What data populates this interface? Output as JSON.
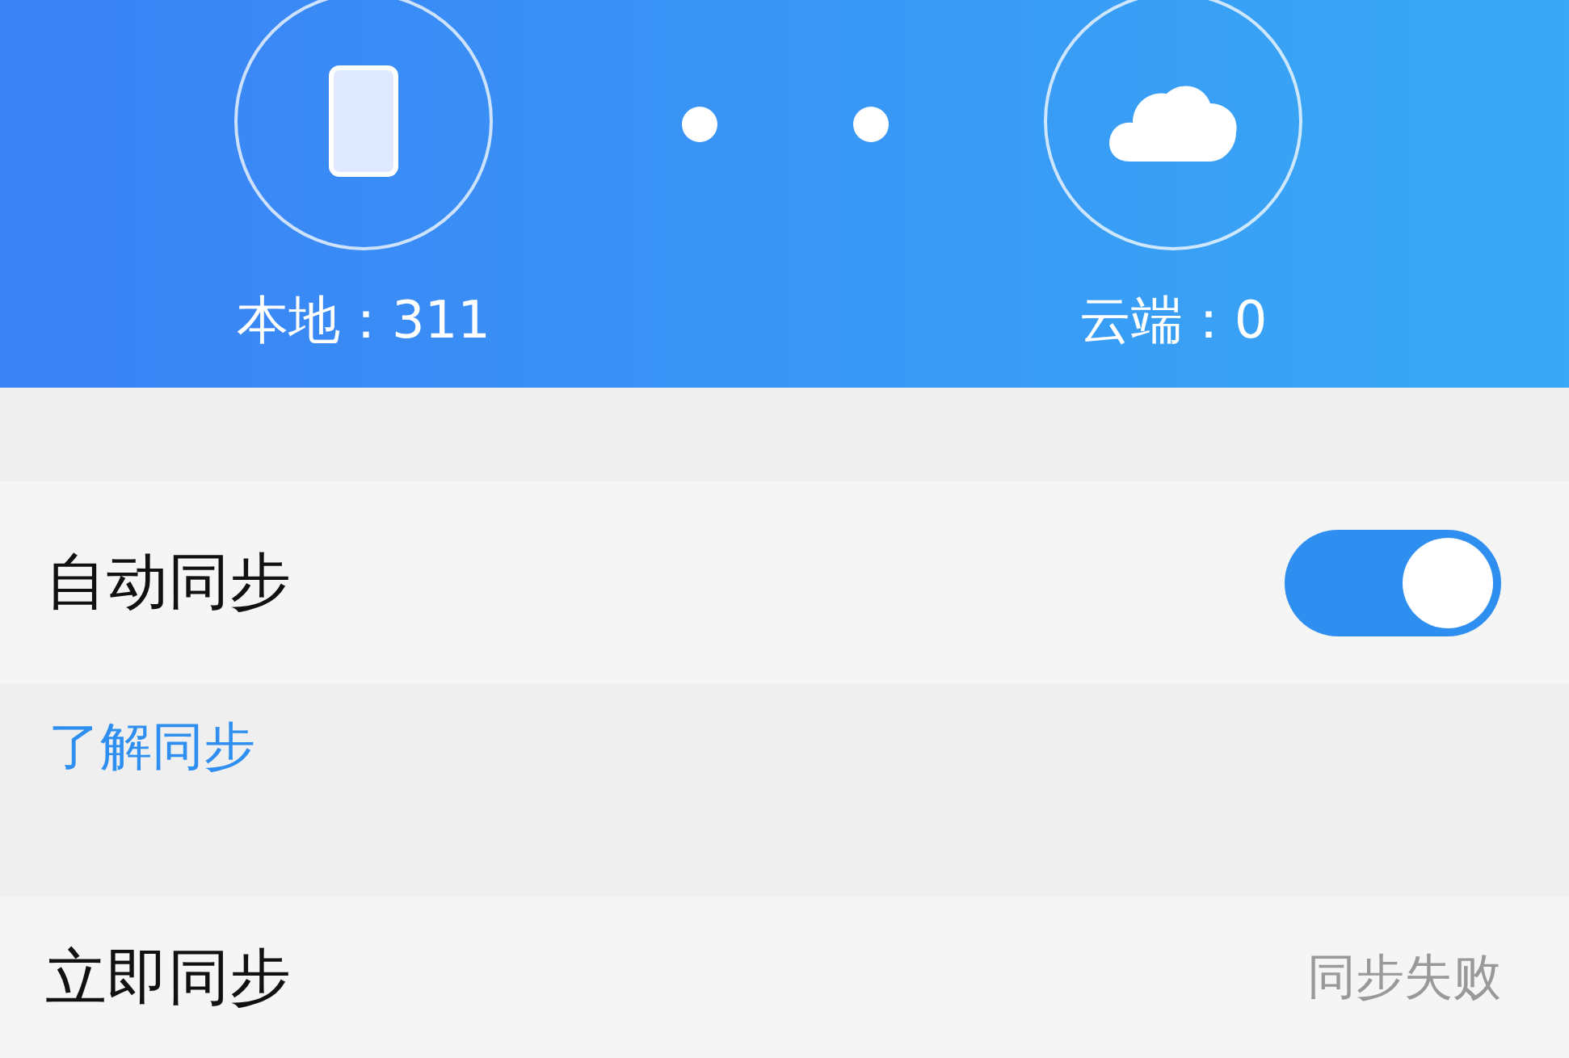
{
  "header": {
    "local": {
      "label": "本地：311"
    },
    "cloud": {
      "label": "云端：0"
    }
  },
  "auto_sync": {
    "label": "自动同步",
    "on": true
  },
  "learn_link": "了解同步",
  "sync_now": {
    "label": "立即同步",
    "status": "同步失败"
  }
}
